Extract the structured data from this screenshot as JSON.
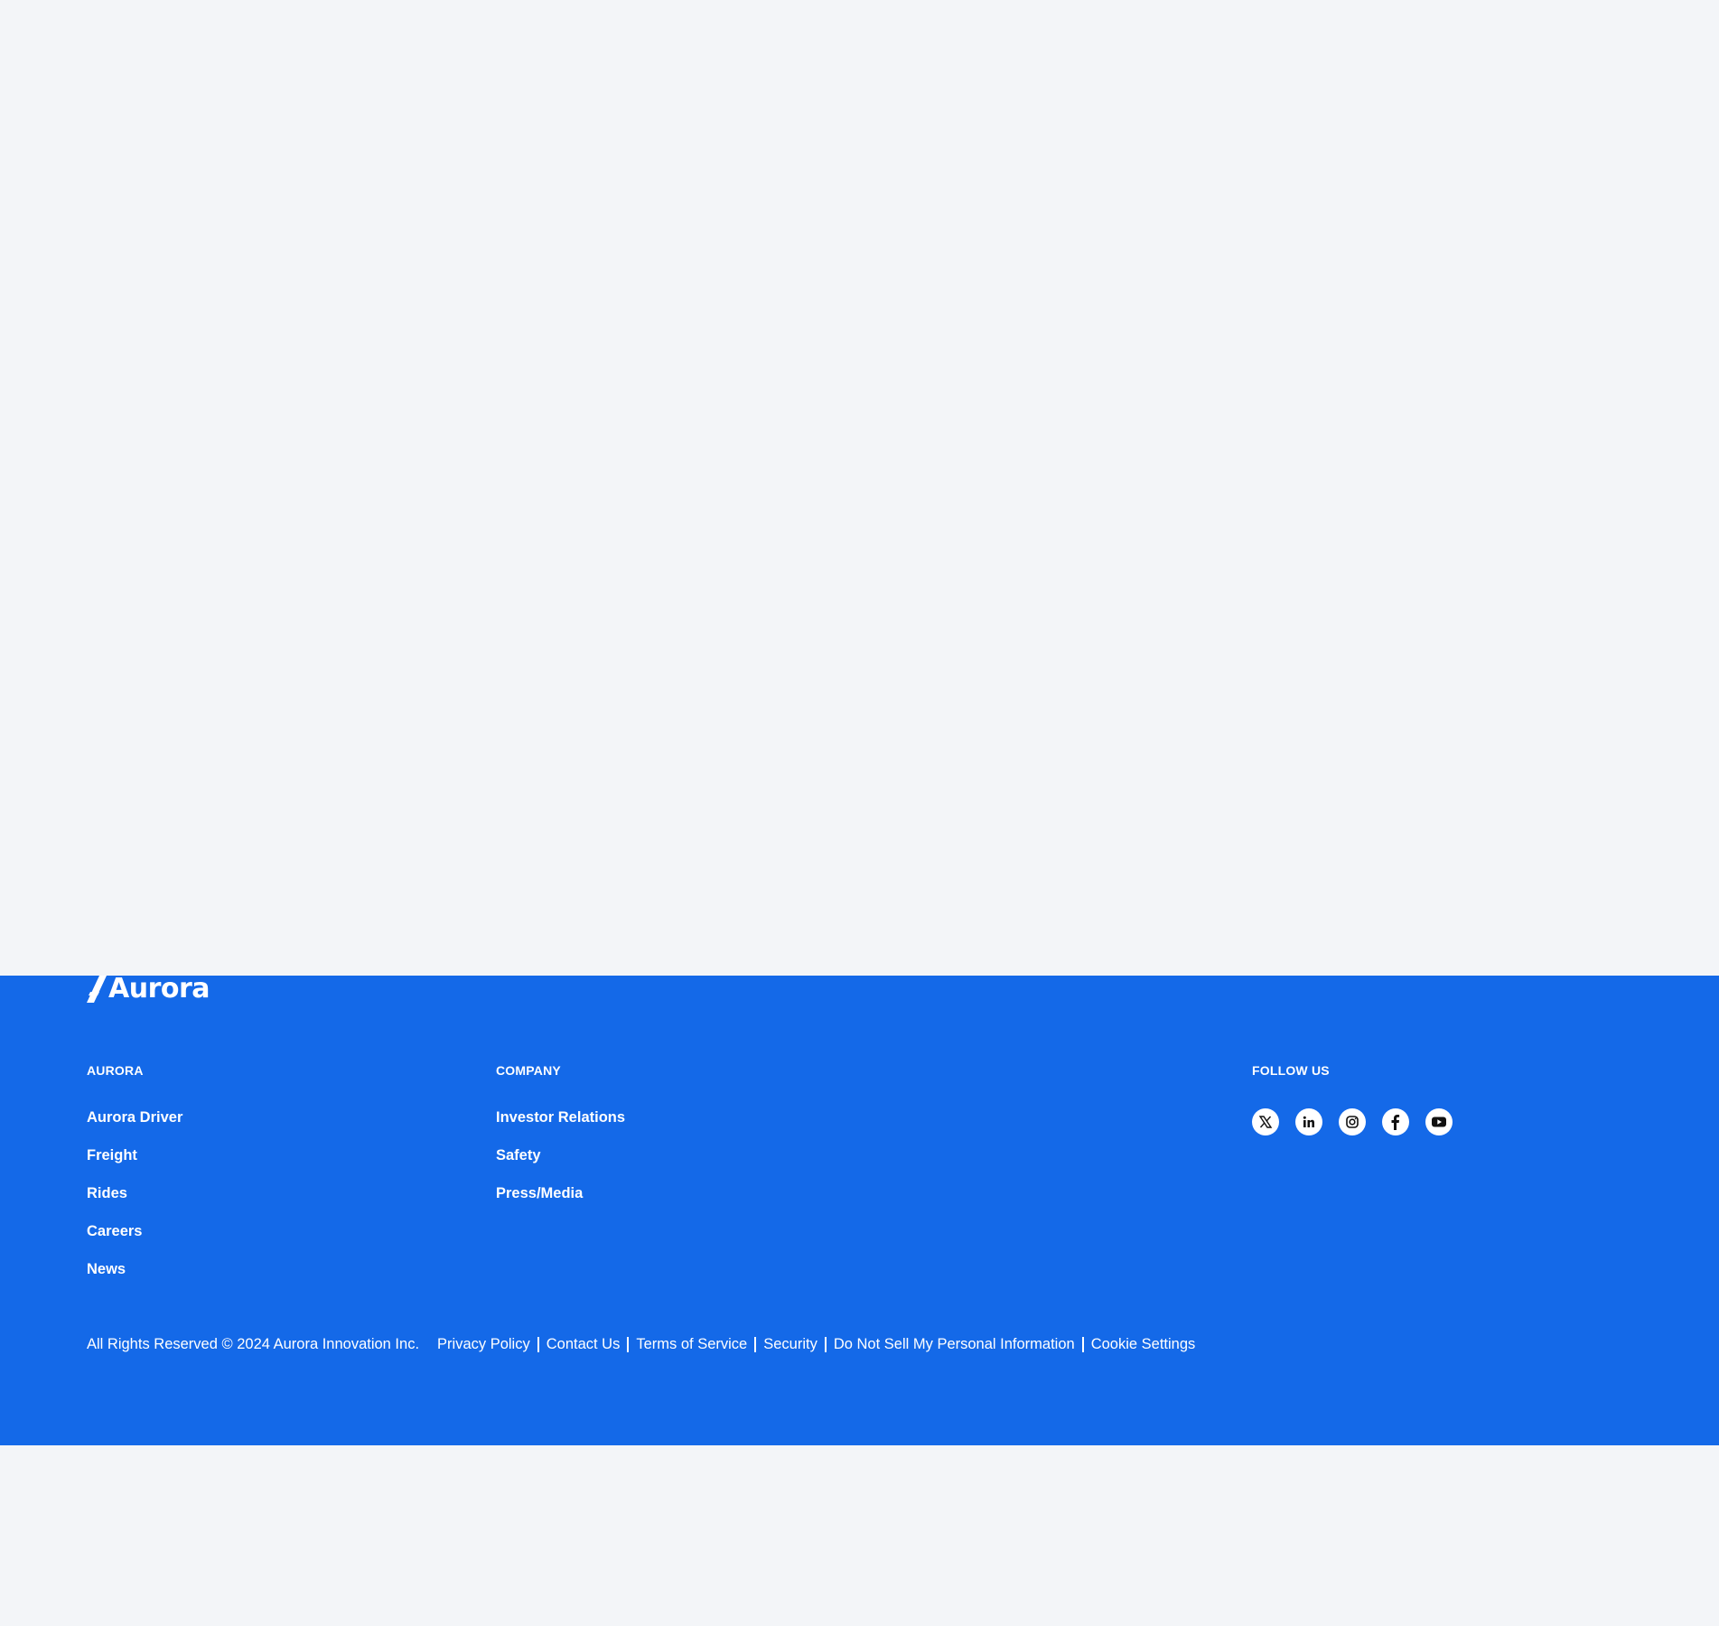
{
  "colors": {
    "footer_background": "#1469e8",
    "page_background": "#f3f5f8",
    "text": "#ffffff",
    "icon_glyph": "#111111"
  },
  "footer": {
    "logo_text": "Aurora",
    "columns": [
      {
        "heading": "AURORA",
        "links": [
          "Aurora Driver",
          "Freight",
          "Rides",
          "Careers",
          "News"
        ]
      },
      {
        "heading": "COMPANY",
        "links": [
          "Investor Relations",
          "Safety",
          "Press/Media"
        ]
      }
    ],
    "follow": {
      "heading": "FOLLOW US",
      "icons": [
        "x-icon",
        "linkedin-icon",
        "instagram-icon",
        "facebook-icon",
        "youtube-icon"
      ]
    },
    "copyright": "All Rights Reserved © 2024 Aurora Innovation Inc.",
    "legal_links": [
      "Privacy Policy",
      "Contact Us",
      "Terms of Service",
      "Security",
      "Do Not Sell My Personal Information",
      "Cookie Settings"
    ]
  }
}
